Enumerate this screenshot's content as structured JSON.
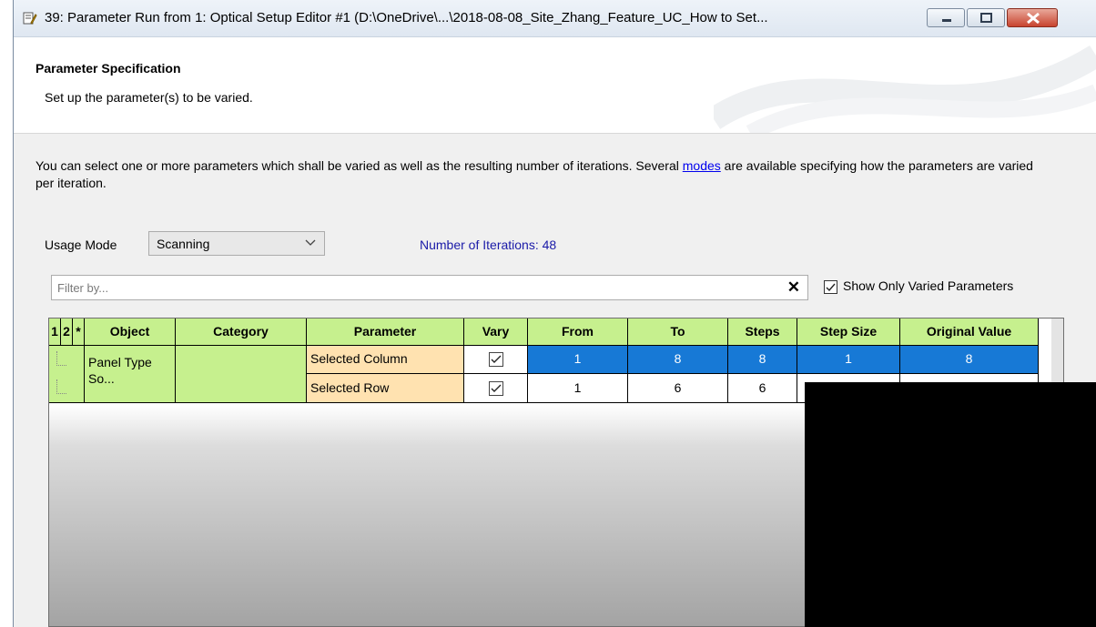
{
  "window": {
    "title": "39: Parameter Run from 1: Optical Setup Editor #1 (D:\\OneDrive\\...\\2018-08-08_Site_Zhang_Feature_UC_How to Set..."
  },
  "header": {
    "title": "Parameter Specification",
    "subtitle": "Set up the parameter(s) to be varied."
  },
  "description": {
    "before": "You can select one or more parameters which shall be varied as well as the resulting number of iterations. Several ",
    "link": "modes",
    "after": " are available specifying how the parameters are varied per iteration."
  },
  "usage": {
    "label": "Usage Mode",
    "value": "Scanning",
    "iterations": "Number of Iterations: 48"
  },
  "filter": {
    "placeholder": "Filter by...",
    "clear": "✕",
    "show_varied_label": "Show Only Varied Parameters",
    "show_varied_checked": true
  },
  "grid": {
    "columns": [
      "1",
      "2",
      "*",
      "Object",
      "Category",
      "Parameter",
      "Vary",
      "From",
      "To",
      "Steps",
      "Step Size",
      "Original Value"
    ],
    "object": "Panel Type So...",
    "category": "",
    "rows": [
      {
        "parameter": "Selected Column",
        "vary": true,
        "from": "1",
        "to": "8",
        "steps": "8",
        "step_size": "1",
        "original": "8",
        "selected": true
      },
      {
        "parameter": "Selected Row",
        "vary": true,
        "from": "1",
        "to": "6",
        "steps": "6",
        "step_size": "",
        "original": "",
        "selected": false
      }
    ]
  }
}
